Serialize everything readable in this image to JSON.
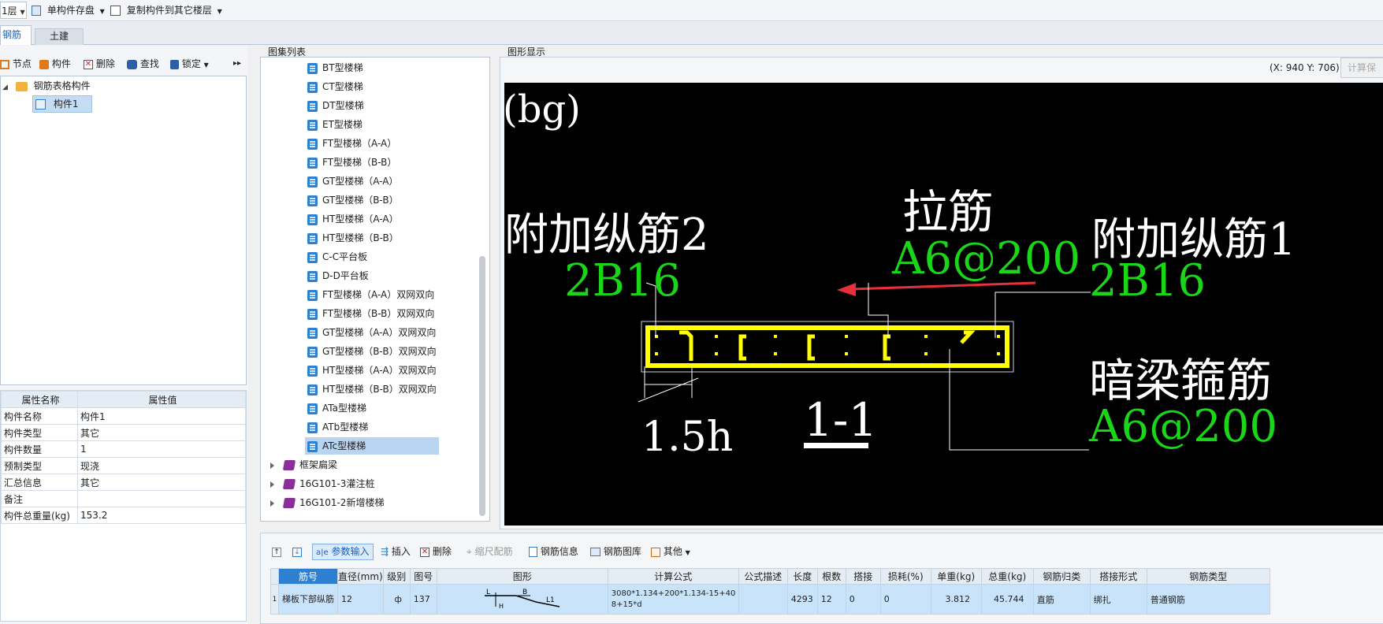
{
  "toolbar": {
    "floor_select": "1层",
    "save_component": "单构件存盘",
    "copy_component": "复制构件到其它楼层"
  },
  "tabs": [
    {
      "label": "钢筋"
    },
    {
      "label": "土建"
    }
  ],
  "left_toolbar": {
    "node": "节点",
    "component": "构件",
    "delete": "删除",
    "find": "查找",
    "lock": "锁定",
    "more": "▸▸"
  },
  "component_tree": {
    "root": "钢筋表格构件",
    "child": "构件1"
  },
  "properties": {
    "col_name": "属性名称",
    "col_value": "属性值",
    "rows": [
      {
        "name": "构件名称",
        "value": "构件1"
      },
      {
        "name": "构件类型",
        "value": "其它"
      },
      {
        "name": "构件数量",
        "value": "1"
      },
      {
        "name": "预制类型",
        "value": "现浇"
      },
      {
        "name": "汇总信息",
        "value": "其它"
      },
      {
        "name": "备注",
        "value": ""
      },
      {
        "name": "构件总重量(kg)",
        "value": "153.2"
      }
    ]
  },
  "atlas": {
    "title": "图集列表",
    "items": [
      "BT型楼梯",
      "CT型楼梯",
      "DT型楼梯",
      "ET型楼梯",
      "FT型楼梯（A-A）",
      "FT型楼梯（B-B）",
      "GT型楼梯（A-A）",
      "GT型楼梯（B-B）",
      "HT型楼梯（A-A）",
      "HT型楼梯（B-B）",
      "C-C平台板",
      "D-D平台板",
      "FT型楼梯（A-A）双网双向",
      "FT型楼梯（B-B）双网双向",
      "GT型楼梯（A-A）双网双向",
      "GT型楼梯（B-B）双网双向",
      "HT型楼梯（A-A）双网双向",
      "HT型楼梯（B-B）双网双向",
      "ATa型楼梯",
      "ATb型楼梯",
      "ATc型楼梯"
    ],
    "selected_index": 20,
    "groups": [
      "框架扁梁",
      "16G101-3灌注桩",
      "16G101-2新增楼梯"
    ]
  },
  "graphic": {
    "title": "图形显示",
    "coords": "(X: 940 Y: 706)",
    "calc_button": "计算保",
    "labels": {
      "bg": "(bg)",
      "extra_long_2": "附加纵筋2",
      "extra_long_2_value": "2B16",
      "tie": "拉筋",
      "tie_value": "A6@200",
      "extra_long_1": "附加纵筋1",
      "extra_long_1_value": "2B16",
      "hidden_beam_stirrup": "暗梁箍筋",
      "hidden_beam_stirrup_value": "A6@200",
      "width_label": "1.5h",
      "section_label": "1-1"
    },
    "colors": {
      "yellow": "#ffff00",
      "green": "#19d619",
      "red": "#e8303a",
      "background": "#000000"
    }
  },
  "bottom_toolbar": {
    "param_input": "参数输入",
    "insert": "插入",
    "delete": "删除",
    "scale_rebar": "缩尺配筋",
    "rebar_info": "钢筋信息",
    "rebar_library": "钢筋图库",
    "other": "其他"
  },
  "rebar_table": {
    "headers": [
      "筋号",
      "直径(mm)",
      "级别",
      "图号",
      "图形",
      "计算公式",
      "公式描述",
      "长度",
      "根数",
      "搭接",
      "损耗(%)",
      "单重(kg)",
      "总重(kg)",
      "钢筋归类",
      "搭接形式",
      "钢筋类型"
    ],
    "rows": [
      {
        "index": "1",
        "name": "梯板下部纵筋",
        "diameter": "12",
        "grade": "ф",
        "figure_no": "137",
        "shape_labels": {
          "l": "L",
          "b": "B",
          "l1": "L1",
          "h": "H"
        },
        "formula": "3080*1.134+200*1.134-15+40 8+15*d",
        "formula_desc": "",
        "length": "4293",
        "count": "12",
        "lap": "0",
        "loss": "0",
        "unit_weight": "3.812",
        "total_weight": "45.744",
        "category": "直筋",
        "lap_type": "绑扎",
        "rebar_type": "普通钢筋"
      }
    ]
  }
}
